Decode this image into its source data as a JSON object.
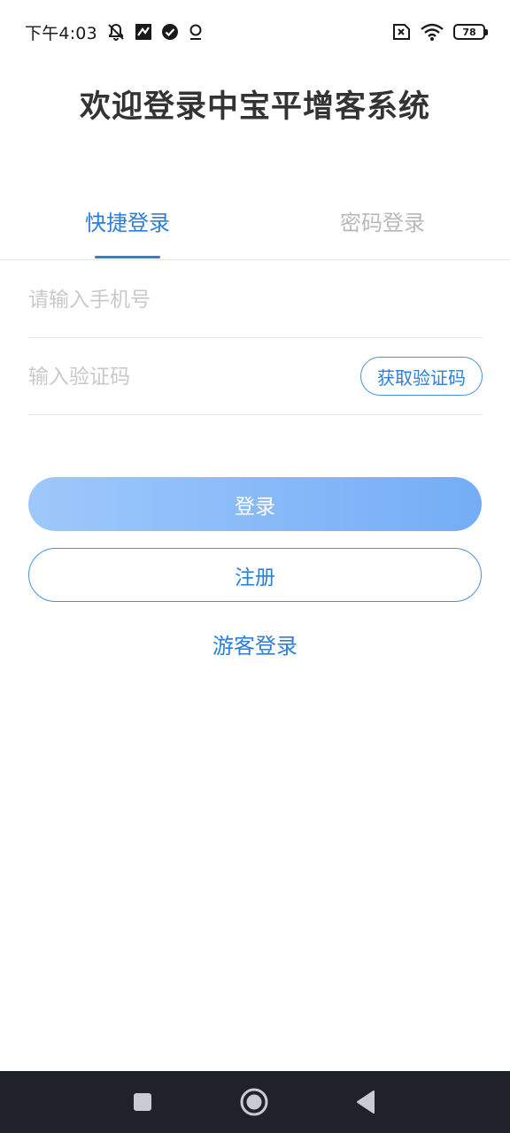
{
  "status_bar": {
    "time": "下午4:03",
    "icons_left": [
      "mute-vibrate-icon",
      "notification-icon",
      "check-circle-icon",
      "location-icon"
    ],
    "icons_right": [
      "sim-card-x-icon",
      "wifi-icon"
    ],
    "battery_level": "78"
  },
  "page": {
    "title": "欢迎登录中宝平增客系统"
  },
  "tabs": {
    "quick_login": "快捷登录",
    "password_login": "密码登录",
    "active": "quick_login"
  },
  "form": {
    "phone_placeholder": "请输入手机号",
    "phone_value": "",
    "code_placeholder": "输入验证码",
    "code_value": "",
    "get_code_label": "获取验证码"
  },
  "actions": {
    "login_label": "登录",
    "register_label": "注册",
    "guest_login_label": "游客登录"
  },
  "colors": {
    "accent": "#2b7fd6",
    "login_gradient_start": "#9ec8fb",
    "login_gradient_end": "#74adf6",
    "nav_bar": "#1f2329"
  },
  "navigation": {
    "icons": [
      "recents-icon",
      "home-icon",
      "back-icon"
    ]
  }
}
